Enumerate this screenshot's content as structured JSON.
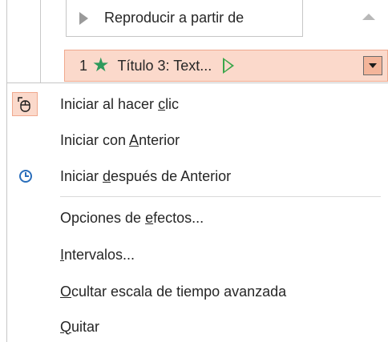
{
  "animation_pane": {
    "play_from_label": "Reproducir a partir de",
    "selected_item": {
      "number": "1",
      "title": "Título 3: Text..."
    }
  },
  "context_menu": {
    "items": [
      {
        "pre": "Iniciar al hacer ",
        "key": "c",
        "post": "lic",
        "icon": "mouse-click-icon",
        "checked": true
      },
      {
        "pre": "Iniciar con ",
        "key": "A",
        "post": "nterior"
      },
      {
        "pre": "Iniciar ",
        "key": "d",
        "post": "espués de Anterior",
        "icon": "clock-icon"
      },
      {
        "pre": "Opciones de ",
        "key": "e",
        "post": "fectos..."
      },
      {
        "pre": "",
        "key": "I",
        "post": "ntervalos..."
      },
      {
        "pre": "",
        "key": "O",
        "post": "cultar escala de tiempo avanzada"
      },
      {
        "pre": "",
        "key": "Q",
        "post": "uitar"
      }
    ]
  },
  "colors": {
    "selection_fill": "#fbd9cb",
    "selection_border": "#f0a98e",
    "star": "#2e9a5c",
    "trigger": "#3aa64a",
    "clock": "#2a6ebb"
  }
}
